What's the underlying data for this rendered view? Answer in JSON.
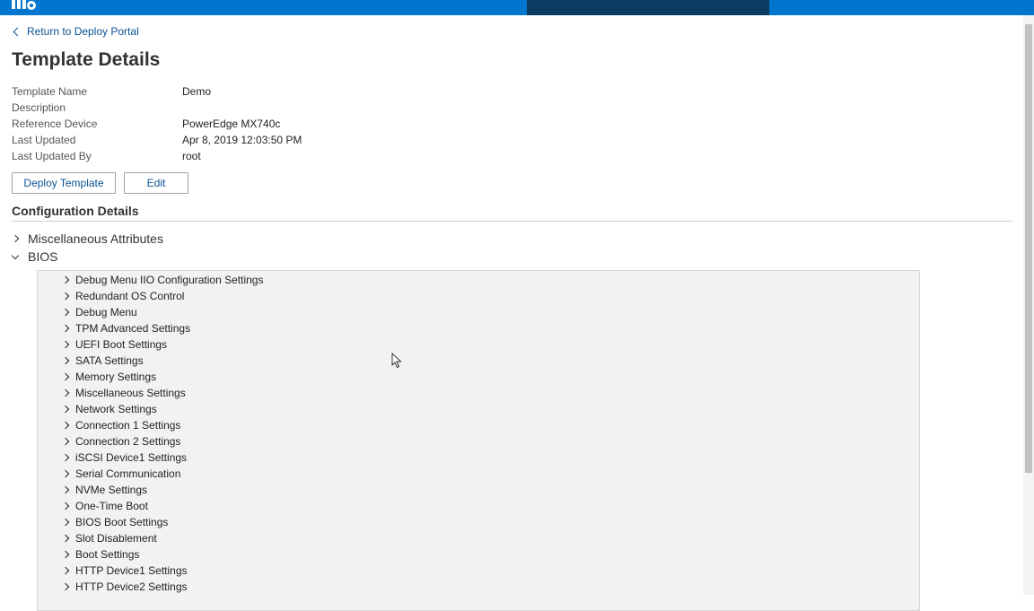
{
  "nav": {
    "back_label": "Return to Deploy Portal"
  },
  "page_title": "Template Details",
  "properties": [
    {
      "label": "Template Name",
      "value": "Demo"
    },
    {
      "label": "Description",
      "value": ""
    },
    {
      "label": "Reference Device",
      "value": "PowerEdge MX740c"
    },
    {
      "label": "Last Updated",
      "value": "Apr 8, 2019 12:03:50 PM"
    },
    {
      "label": "Last Updated By",
      "value": "root"
    }
  ],
  "buttons": {
    "deploy_label": "Deploy Template",
    "edit_label": "Edit"
  },
  "config": {
    "heading": "Configuration Details",
    "misc_label": "Miscellaneous Attributes",
    "bios_label": "BIOS",
    "bios_items": [
      "Debug Menu IIO Configuration Settings",
      "Redundant OS Control",
      "Debug Menu",
      "TPM Advanced Settings",
      "UEFI Boot Settings",
      "SATA Settings",
      "Memory Settings",
      "Miscellaneous Settings",
      "Network Settings",
      "Connection 1 Settings",
      "Connection 2 Settings",
      "iSCSI Device1 Settings",
      "Serial Communication",
      "NVMe Settings",
      "One-Time Boot",
      "BIOS Boot Settings",
      "Slot Disablement",
      "Boot Settings",
      "HTTP Device1 Settings",
      "HTTP Device2 Settings"
    ]
  },
  "colors": {
    "header_bg": "#0076ce",
    "header_dark": "#0b3b60",
    "link": "#0b5394"
  }
}
